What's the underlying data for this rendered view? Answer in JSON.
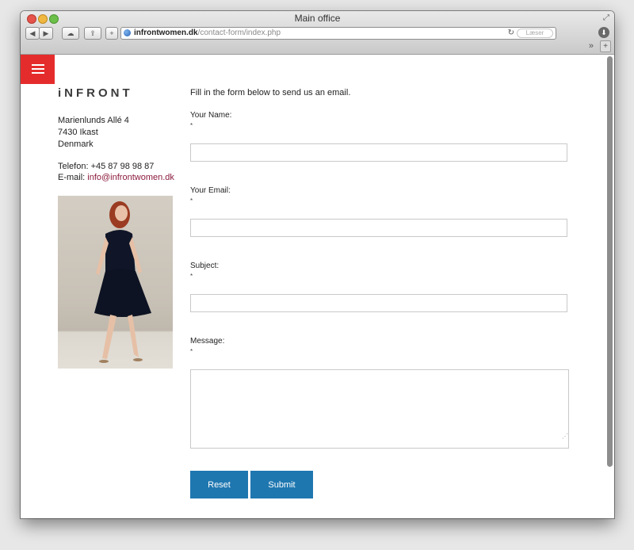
{
  "window": {
    "title": "Main office",
    "url_host": "infrontwomen.dk",
    "url_path": "/contact-form/index.php",
    "reader_label": "Læser",
    "overflow": "»",
    "newtab": "+"
  },
  "sidebar": {
    "logo": "iNFRONT",
    "address_line1": "Marienlunds Allé 4",
    "address_line2": "7430 Ikast",
    "address_line3": "Denmark",
    "phone": "Telefon: +45 87 98 98 87",
    "email_label": "E-mail: ",
    "email": "info@infrontwomen.dk"
  },
  "form": {
    "intro": "Fill in the form below to send us an email.",
    "name_label": "Your Name:",
    "email_label": "Your Email:",
    "subject_label": "Subject:",
    "message_label": "Message:",
    "required_mark": "*",
    "name_value": "",
    "email_value": "",
    "subject_value": "",
    "message_value": "",
    "reset_label": "Reset",
    "submit_label": "Submit"
  },
  "colors": {
    "menu": "#e52c2c",
    "button": "#1f77b0",
    "email_link": "#8b1a3d"
  }
}
